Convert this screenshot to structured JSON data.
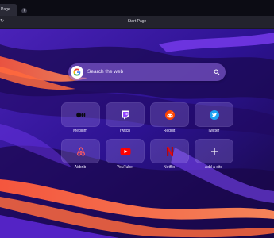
{
  "tabbar": {
    "active_tab_label": "Page",
    "new_tab_symbol": "+"
  },
  "addressbar": {
    "url_text": "Start Page",
    "back_symbol": "↻"
  },
  "search": {
    "placeholder": "Search the web",
    "engine_icon": "google-icon"
  },
  "speed_dial": [
    {
      "label": "Medium",
      "icon": "medium-icon"
    },
    {
      "label": "Twitch",
      "icon": "twitch-icon"
    },
    {
      "label": "Reddit",
      "icon": "reddit-icon"
    },
    {
      "label": "Twitter",
      "icon": "twitter-icon"
    },
    {
      "label": "Airbnb",
      "icon": "airbnb-icon"
    },
    {
      "label": "YouTube",
      "icon": "youtube-icon"
    },
    {
      "label": "Netflix",
      "icon": "netflix-icon"
    },
    {
      "label": "Add a site",
      "icon": "plus-icon"
    }
  ],
  "colors": {
    "accent_orange": "#ff6a3d",
    "purple_dark": "#1a0a55",
    "purple_mid": "#3b1a9a",
    "tile_bg": "#bea9ff",
    "twitter_blue": "#1da1f2",
    "youtube_red": "#ff0000",
    "reddit_orange": "#ff4500",
    "airbnb_pink": "#ff5a5f",
    "netflix_red": "#e50914"
  }
}
